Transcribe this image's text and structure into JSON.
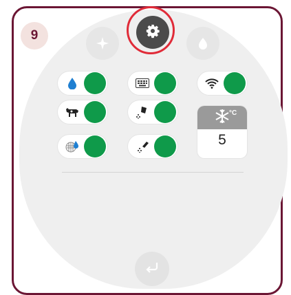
{
  "step_number": "9",
  "colors": {
    "frame": "#6b1634",
    "accent_ring": "#e02b38",
    "toggle_on": "#0f9a4a",
    "panel": "#efefef"
  },
  "mode_buttons": [
    {
      "name": "sparkle-icon",
      "active": false
    },
    {
      "name": "gear-icon",
      "active": true
    },
    {
      "name": "powder-drops-icon",
      "active": false
    }
  ],
  "toggles": [
    {
      "name": "water-drop-icon",
      "state": "on"
    },
    {
      "name": "keyboard-icon",
      "state": "on"
    },
    {
      "name": "wifi-icon",
      "state": "on"
    },
    {
      "name": "cow-icon",
      "state": "on"
    },
    {
      "name": "milk-pitcher-icon",
      "state": "on"
    },
    {
      "name": "milk-frother-icon",
      "state": "on"
    },
    {
      "name": "filter-icon",
      "state": "on"
    }
  ],
  "temperature": {
    "unit": "°C",
    "value": "5",
    "icon": "snowflake-icon"
  },
  "back_button": {
    "icon": "return-icon"
  }
}
